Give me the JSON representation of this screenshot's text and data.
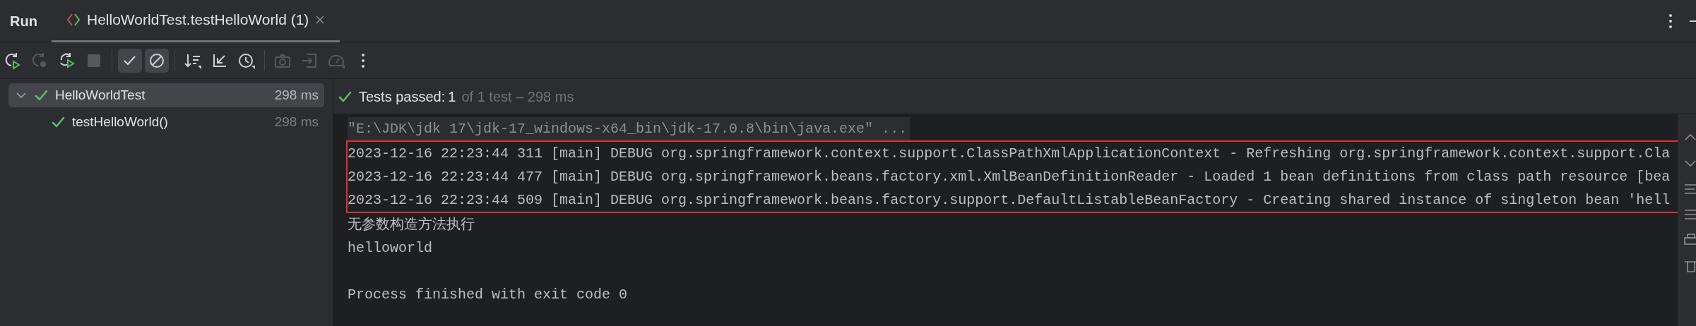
{
  "window": {
    "title": "Run"
  },
  "tabs": [
    {
      "label": "HelloWorldTest.testHelloWorld (1)",
      "selected": true
    }
  ],
  "toolbar": [
    {
      "kind": "button",
      "disabled": false,
      "selected": false
    },
    {
      "kind": "button",
      "disabled": true,
      "selected": false
    },
    {
      "kind": "button",
      "disabled": false,
      "selected": false
    },
    {
      "kind": "button",
      "disabled": true,
      "selected": false
    },
    {
      "kind": "separator"
    },
    {
      "kind": "button",
      "disabled": false,
      "selected": true
    },
    {
      "kind": "button",
      "disabled": false,
      "selected": true
    },
    {
      "kind": "separator"
    },
    {
      "kind": "button",
      "disabled": false,
      "selected": false
    },
    {
      "kind": "button",
      "disabled": false,
      "selected": false
    },
    {
      "kind": "button",
      "disabled": false,
      "selected": false
    },
    {
      "kind": "separator"
    },
    {
      "kind": "button",
      "disabled": true,
      "selected": false
    },
    {
      "kind": "button",
      "disabled": true,
      "selected": false
    },
    {
      "kind": "button",
      "disabled": true,
      "selected": false
    },
    {
      "kind": "button",
      "disabled": false,
      "selected": false
    }
  ],
  "tree": [
    {
      "label": "HelloWorldTest",
      "time": "298 ms",
      "expanded": true,
      "selected": true,
      "passed": true,
      "children": [
        {
          "label": "testHelloWorld()",
          "time": "298 ms",
          "selected": false,
          "passed": true
        }
      ]
    }
  ],
  "status": {
    "passed": true,
    "label": "Tests passed:",
    "count": "1",
    "detail": "of 1 test – 298 ms"
  },
  "console": [
    {
      "kind": "command",
      "text": "\"E:\\JDK\\jdk 17\\jdk-17_windows-x64_bin\\jdk-17.0.8\\bin\\java.exe\" ...",
      "boxed": false
    },
    {
      "kind": "output",
      "text": "2023-12-16 22:23:44 311 [main] DEBUG org.springframework.context.support.ClassPathXmlApplicationContext - Refreshing org.springframework.context.support.Cla",
      "boxed": true
    },
    {
      "kind": "output",
      "text": "2023-12-16 22:23:44 477 [main] DEBUG org.springframework.beans.factory.xml.XmlBeanDefinitionReader - Loaded 1 bean definitions from class path resource [bea",
      "boxed": true
    },
    {
      "kind": "output",
      "text": "2023-12-16 22:23:44 509 [main] DEBUG org.springframework.beans.factory.support.DefaultListableBeanFactory - Creating shared instance of singleton bean 'hell",
      "boxed": true
    },
    {
      "kind": "output",
      "text": "无参数构造方法执行",
      "boxed": false
    },
    {
      "kind": "output",
      "text": "helloworld",
      "boxed": false
    },
    {
      "kind": "blank"
    },
    {
      "kind": "output",
      "text": "Process finished with exit code 0",
      "boxed": false
    }
  ]
}
